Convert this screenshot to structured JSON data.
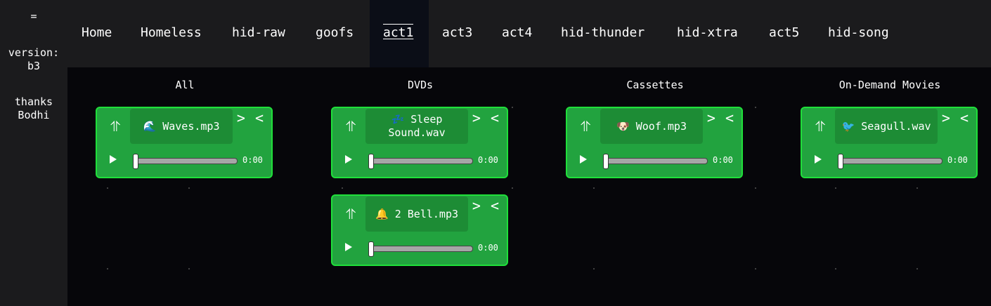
{
  "sidebar": {
    "menu_toggle": "=",
    "version_label": "version:",
    "version_value": "b3",
    "thanks_line1": "thanks",
    "thanks_line2": "Bodhi"
  },
  "nav": {
    "items": [
      {
        "label": "Home"
      },
      {
        "label": "Homeless"
      },
      {
        "label": "hid-raw"
      },
      {
        "label": "goofs"
      },
      {
        "label": "act1",
        "active": true
      },
      {
        "label": "act3"
      },
      {
        "label": "act4"
      },
      {
        "label": "hid-thunder"
      },
      {
        "label": "hid-xtra"
      },
      {
        "label": "act5"
      },
      {
        "label": "hid-song"
      }
    ]
  },
  "columns": [
    {
      "title": "All"
    },
    {
      "title": "DVDs"
    },
    {
      "title": "Cassettes"
    },
    {
      "title": "On-Demand Movies"
    }
  ],
  "cards": [
    {
      "icon": "🌊",
      "name": "Waves.mp3",
      "time": "0:00",
      "handle": "⥣",
      "move": "> <",
      "progress": 0
    },
    {
      "icon": "💤",
      "name": "Sleep Sound.wav",
      "time": "0:00",
      "handle": "⥣",
      "move": "> <",
      "progress": 0
    },
    {
      "icon": "🔔",
      "name": "2 Bell.mp3",
      "time": "0:00",
      "handle": "⥣",
      "move": "> <",
      "progress": 0
    },
    {
      "icon": "🐶",
      "name": "Woof.mp3",
      "time": "0:00",
      "handle": "⥣",
      "move": "> <",
      "progress": 0
    },
    {
      "icon": "🐦",
      "name": "Seagull.wav",
      "time": "0:00",
      "handle": "⥣",
      "move": "> <",
      "progress": 0
    }
  ],
  "icons": {
    "drag_handle": "drag-handle-icon",
    "play": "play-icon"
  },
  "colors": {
    "card_bg": "#22a33f",
    "card_border": "#1fe03a",
    "title_box_bg": "#1d8c35",
    "board_bg": "#06060a",
    "nav_bg": "#1b1b1d",
    "nav_active_bg": "#0b0e17"
  }
}
